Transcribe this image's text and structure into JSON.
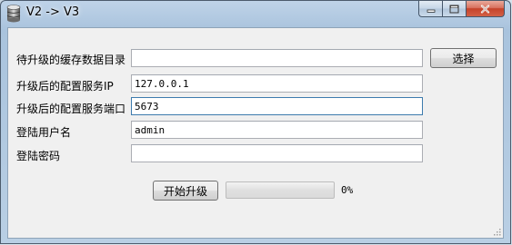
{
  "window": {
    "title": "V2 -> V3",
    "controls": {
      "minimize": "minimize",
      "maximize": "maximize",
      "close": "close"
    }
  },
  "form": {
    "cache_dir": {
      "label": "待升级的缓存数据目录",
      "value": ""
    },
    "browse_button": "选择",
    "config_ip": {
      "label": "升级后的配置服务IP",
      "value": "127.0.0.1"
    },
    "config_port": {
      "label": "升级后的配置服务端口",
      "value": "5673"
    },
    "username": {
      "label": "登陆用户名",
      "value": "admin"
    },
    "password": {
      "label": "登陆密码",
      "value": ""
    }
  },
  "actions": {
    "start_button": "开始升级",
    "progress_percent": 0,
    "progress_text": "0%"
  },
  "colors": {
    "close_button": "#c5432a",
    "client_bg": "#f0f0f0",
    "focus_border": "#3d7bad"
  }
}
